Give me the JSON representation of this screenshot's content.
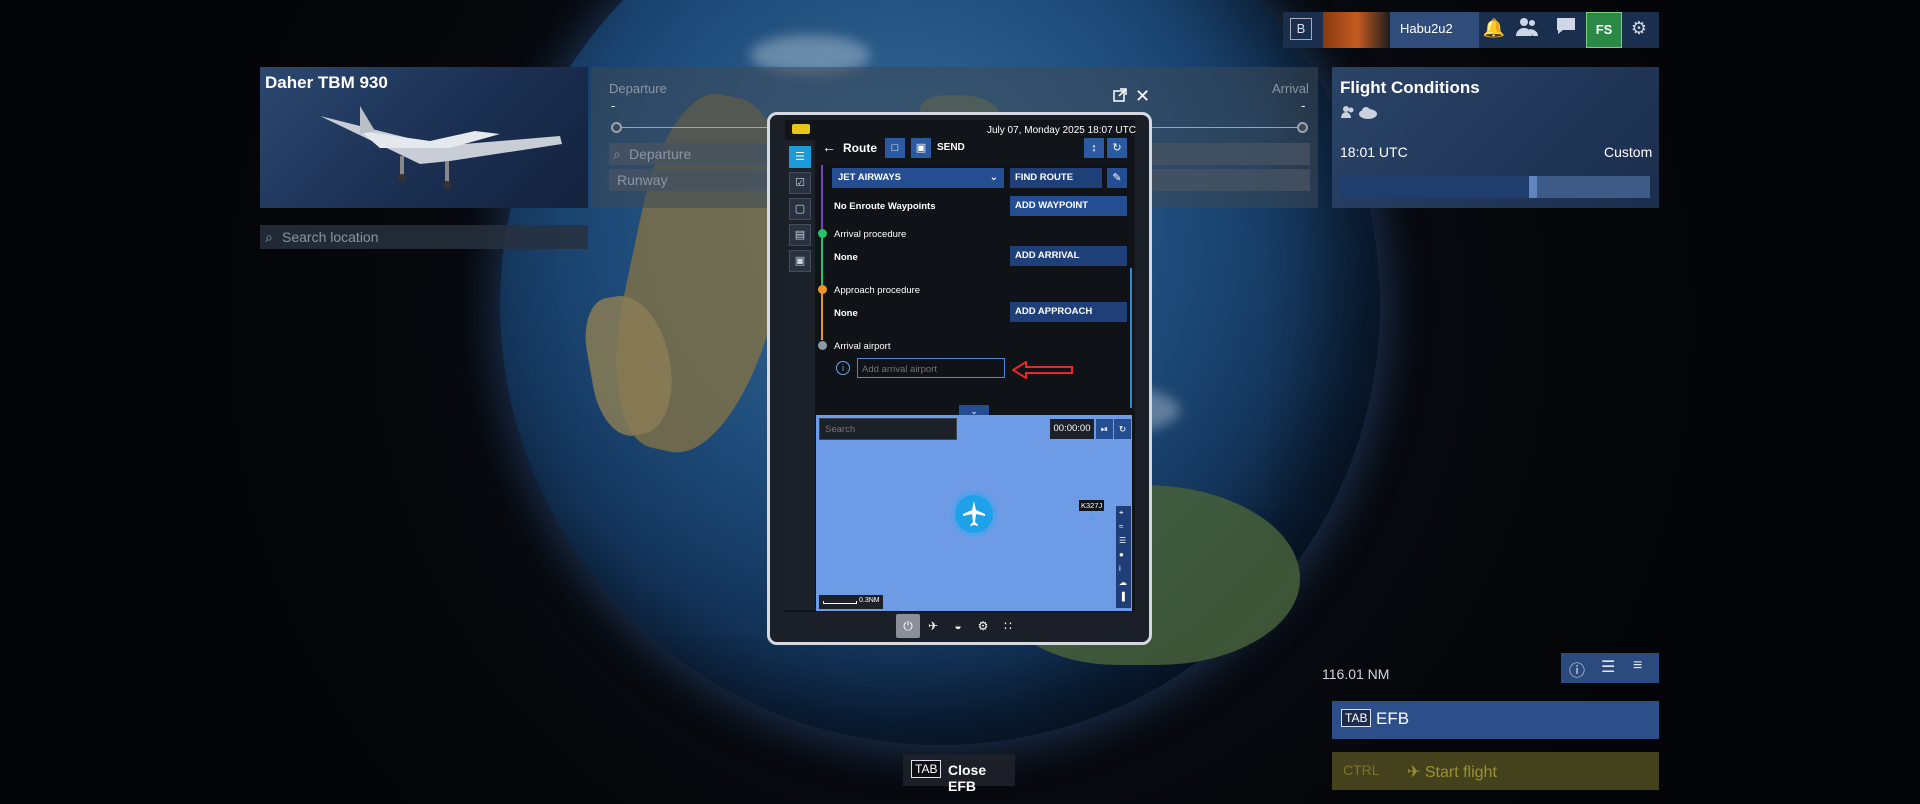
{
  "topbar": {
    "b_key": "B",
    "username": "Habu2u2",
    "icons": [
      "bell-icon",
      "friends-icon",
      "chat-icon",
      "marketplace-icon",
      "gear-icon"
    ],
    "shop_label": "FS"
  },
  "aircraft": {
    "name": "Daher TBM 930"
  },
  "search_location": {
    "placeholder": "Search location"
  },
  "route_panel": {
    "departure_label": "Departure",
    "arrival_label": "Arrival",
    "departure_dash": "-",
    "arrival_dash": "-",
    "departure_placeholder": "Departure",
    "runway_placeholder": "Runway"
  },
  "flight_conditions": {
    "title": "Flight Conditions",
    "time": "18:01 UTC",
    "mode": "Custom",
    "time_of_day_fraction": 0.61
  },
  "map_tools": {
    "icons": [
      "info-icon",
      "layers-icon",
      "filter-icon"
    ],
    "distance": "116.01 NM"
  },
  "efb_button": {
    "key": "TAB",
    "label": "EFB"
  },
  "start_button": {
    "key": "CTRL",
    "label": "Start flight"
  },
  "close_efb": {
    "key": "TAB",
    "label": "Close EFB"
  },
  "efb": {
    "datetime": "July 07, Monday 2025 18:07 UTC",
    "header": {
      "title": "Route",
      "send": "SEND"
    },
    "airway_dropdown": "JET AIRWAYS",
    "find_route": "FIND ROUTE",
    "no_waypoints": "No Enroute Waypoints",
    "add_waypoint": "ADD WAYPOINT",
    "arrival_procedure_label": "Arrival procedure",
    "arrival_procedure_value": "None",
    "add_arrival": "ADD ARRIVAL",
    "approach_procedure_label": "Approach procedure",
    "approach_procedure_value": "None",
    "add_approach": "ADD APPROACH",
    "arrival_airport_label": "Arrival airport",
    "arrival_airport_placeholder": "Add arrival airport",
    "map_search_placeholder": "Search",
    "timer": "00:00:00",
    "traffic_tag": "K327J",
    "scale": "0.3NM",
    "colors": {
      "accent": "#254e92",
      "active_tab": "#1b9bd7",
      "arrival_point": "#26c26a",
      "approach_point": "#f0922a",
      "map_water": "#6d9be6",
      "annotation_arrow": "#e8262b"
    }
  }
}
